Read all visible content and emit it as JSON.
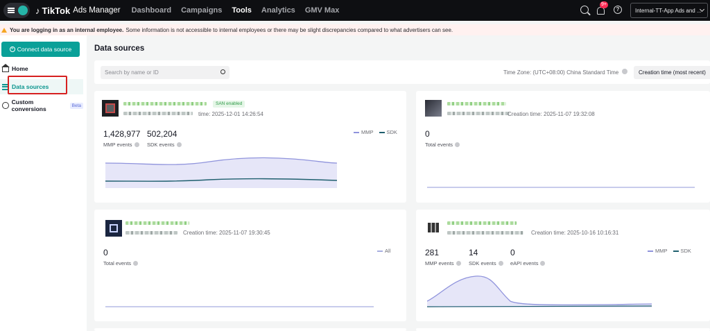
{
  "topnav": {
    "brand": "TikTok",
    "brand_sub": "Ads Manager",
    "items": [
      "Dashboard",
      "Campaigns",
      "Tools",
      "Analytics",
      "GMV Max"
    ],
    "active": "Tools",
    "notification_badge": "9+",
    "account": "Internal-TT-App Ads and ..."
  },
  "banner": {
    "bold": "You are logging in as an internal employee.",
    "text": "Some information is not accessible to internal employees or there may be slight discrepancies compared to what advertisers can see."
  },
  "sidebar": {
    "connect_label": "Connect data source",
    "items": [
      {
        "label": "Home"
      },
      {
        "label": "Data sources"
      },
      {
        "label": "Custom conversions",
        "badge": "Beta"
      }
    ]
  },
  "main": {
    "title": "Data sources",
    "search_placeholder": "Search by name or ID",
    "timezone": "Time Zone: (UTC+08:00) China Standard Time",
    "sort": "Creation time (most recent)"
  },
  "cards": [
    {
      "tag": "SAN enabled",
      "creation": "time: 2025-12-01 14:26:54",
      "metrics": [
        {
          "value": "1,428,977",
          "label": "MMP events"
        },
        {
          "value": "502,204",
          "label": "SDK events"
        }
      ],
      "legend": [
        "MMP",
        "SDK"
      ]
    },
    {
      "creation": "Creation time: 2025-11-07 19:32:08",
      "metrics": [
        {
          "value": "0",
          "label": "Total events"
        }
      ]
    },
    {
      "creation": "Creation time: 2025-11-07 19:30:45",
      "metrics": [
        {
          "value": "0",
          "label": "Total events"
        }
      ],
      "legend": [
        "All"
      ]
    },
    {
      "creation": "Creation time: 2025-10-16 10:16:31",
      "metrics": [
        {
          "value": "281",
          "label": "MMP events"
        },
        {
          "value": "14",
          "label": "SDK events"
        },
        {
          "value": "0",
          "label": "eAPI events"
        }
      ],
      "legend": [
        "MMP",
        "SDK"
      ]
    }
  ],
  "colors": {
    "accent": "#0aa098",
    "mmp": "#8f93dc",
    "sdk": "#1f5f6e",
    "highlight": "#d62020"
  }
}
